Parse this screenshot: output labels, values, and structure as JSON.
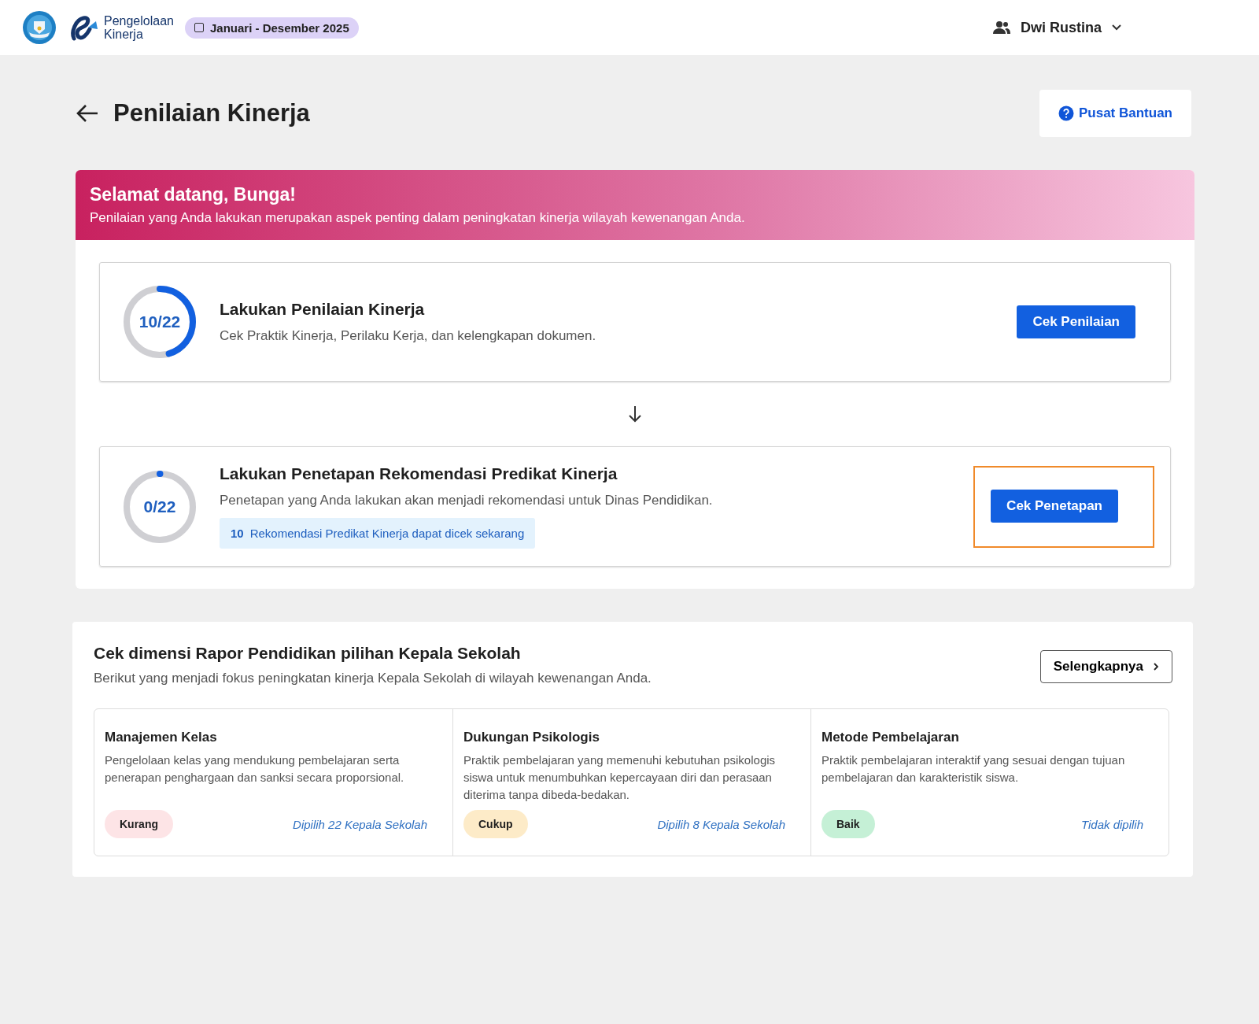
{
  "header": {
    "app_name_line1": "Pengelolaan",
    "app_name_line2": "Kinerja",
    "period": "Januari - Desember 2025",
    "user_name": "Dwi Rustina"
  },
  "page": {
    "title": "Penilaian Kinerja",
    "help_button": "Pusat Bantuan"
  },
  "welcome": {
    "title": "Selamat datang, Bunga!",
    "subtitle": "Penilaian yang Anda lakukan merupakan aspek penting dalam peningkatan kinerja wilayah kewenangan Anda."
  },
  "steps": [
    {
      "progress": "10/22",
      "level": 0.4545,
      "title": "Lakukan Penilaian Kinerja",
      "description": "Cek Praktik Kinerja, Perilaku Kerja, dan kelengkapan dokumen.",
      "button": "Cek Penilaian",
      "highlighted": false
    },
    {
      "progress": "0/22",
      "level": 0,
      "title": "Lakukan Penetapan Rekomendasi Predikat Kinerja",
      "description": "Penetapan yang Anda lakukan akan menjadi rekomendasi untuk Dinas Pendidikan.",
      "notice_count": "10",
      "notice_text": "Rekomendasi Predikat Kinerja dapat dicek sekarang",
      "button": "Cek Penetapan",
      "highlighted": true
    }
  ],
  "dimensions": {
    "title": "Cek dimensi Rapor Pendidikan pilihan Kepala Sekolah",
    "subtitle": "Berikut yang menjadi fokus peningkatan kinerja Kepala Sekolah di wilayah kewenangan Anda.",
    "more_button": "Selengkapnya",
    "items": [
      {
        "title": "Manajemen Kelas",
        "description": "Pengelolaan kelas yang mendukung pembelajaran serta penerapan penghargaan dan sanksi secara proporsional.",
        "tag": "Kurang",
        "color": "#fde4e6",
        "chosen": "Dipilih 22 Kepala Sekolah"
      },
      {
        "title": "Dukungan Psikologis",
        "description": "Praktik pembelajaran yang memenuhi kebutuhan psikologis siswa untuk menumbuhkan kepercayaan diri dan perasaan diterima tanpa dibeda-bedakan.",
        "tag": "Cukup",
        "color": "#fdebc8",
        "chosen": "Dipilih 8 Kepala Sekolah"
      },
      {
        "title": "Metode Pembelajaran",
        "description": "Praktik pembelajaran interaktif yang sesuai dengan tujuan pembelajaran dan karakteristik siswa.",
        "tag": "Baik",
        "color": "#c5f0d6",
        "chosen": "Tidak dipilih"
      }
    ]
  }
}
